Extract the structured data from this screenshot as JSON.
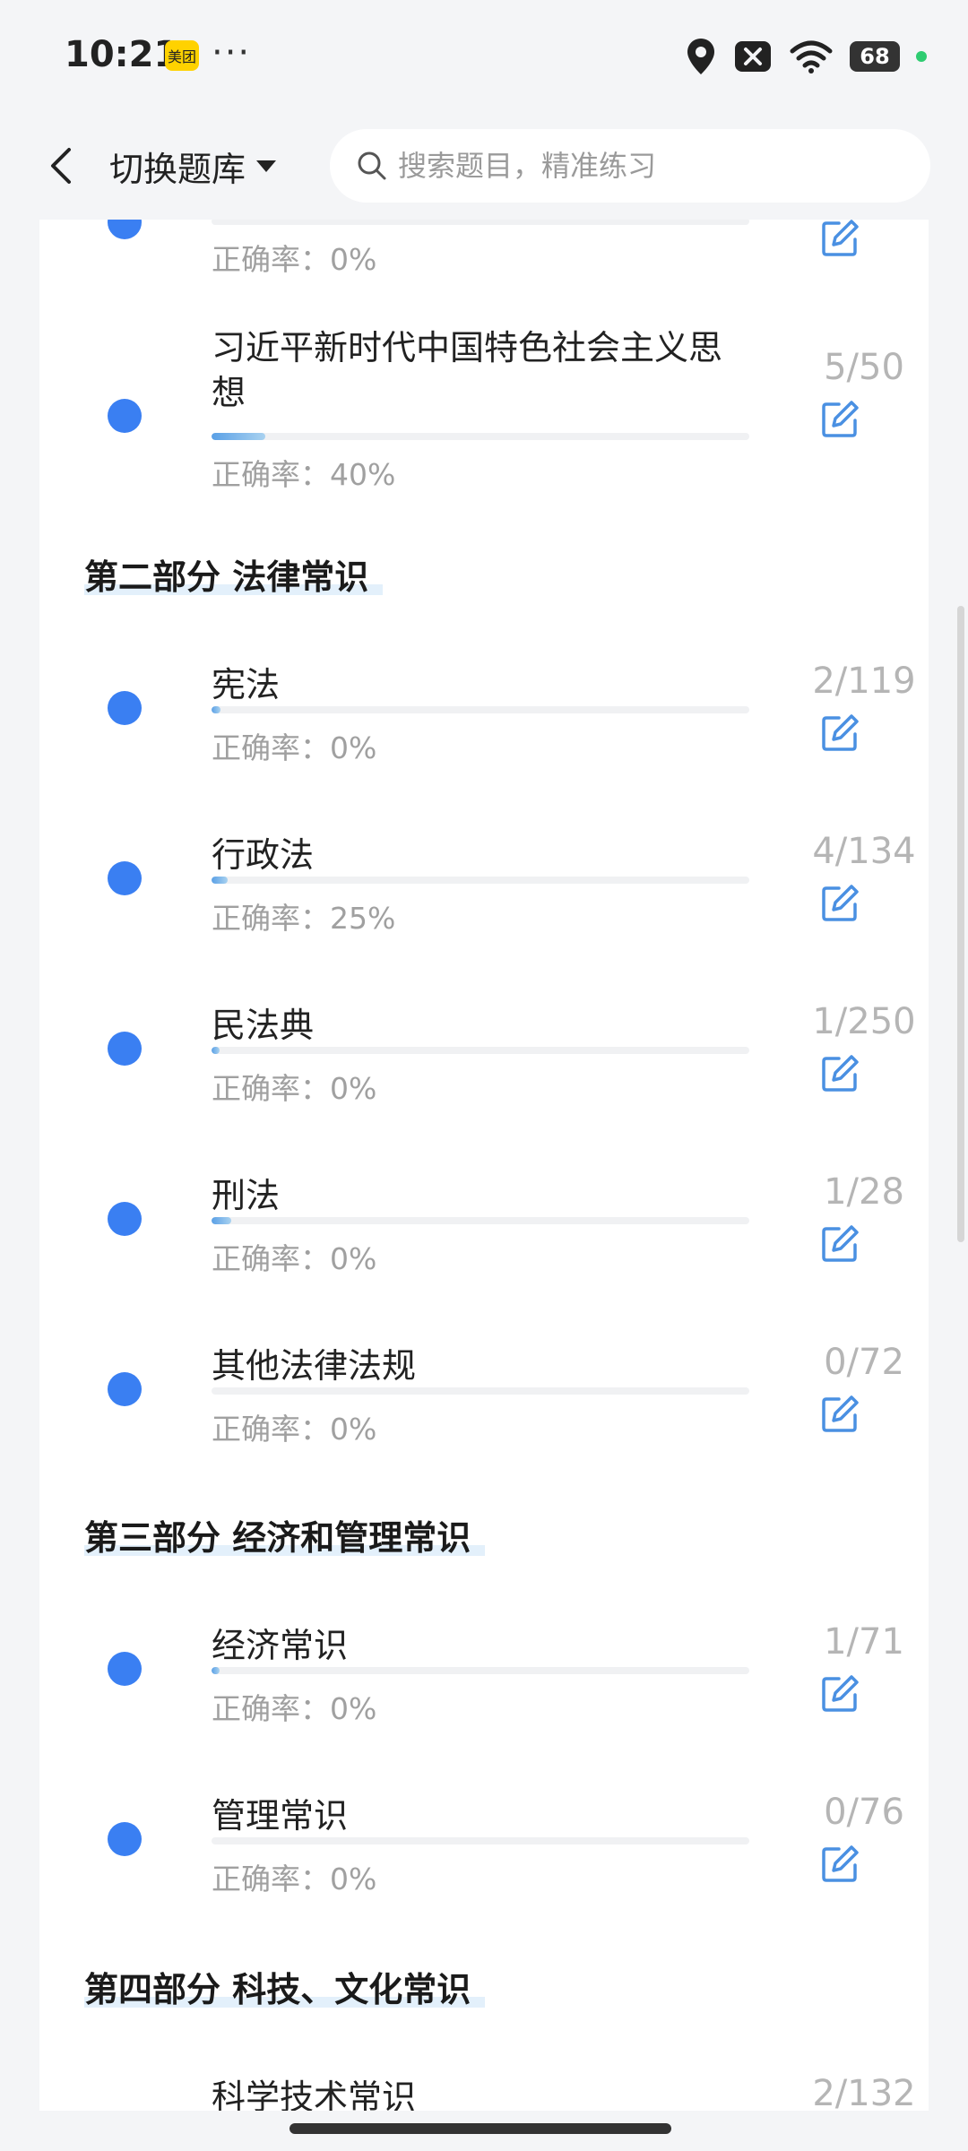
{
  "status_bar": {
    "time": "10:21",
    "app_badge": "美团",
    "more": "···",
    "battery": "68"
  },
  "header": {
    "switch_label": "切换题库",
    "search_placeholder": "搜索题目，精准练习"
  },
  "accuracy_prefix": "正确率：",
  "items_top": [
    {
      "title": "",
      "accuracy": "0%",
      "count": "",
      "progress": 0
    },
    {
      "title": "习近平新时代中国特色社会主义思想",
      "accuracy": "40%",
      "count": "5/50",
      "progress": 0.1
    }
  ],
  "sections": [
    {
      "title": "第二部分  法律常识",
      "items": [
        {
          "title": "宪法",
          "accuracy": "0%",
          "count": "2/119",
          "progress": 0.017
        },
        {
          "title": "行政法",
          "accuracy": "25%",
          "count": "4/134",
          "progress": 0.03
        },
        {
          "title": "民法典",
          "accuracy": "0%",
          "count": "1/250",
          "progress": 0.004
        },
        {
          "title": "刑法",
          "accuracy": "0%",
          "count": "1/28",
          "progress": 0.036
        },
        {
          "title": "其他法律法规",
          "accuracy": "0%",
          "count": "0/72",
          "progress": 0
        }
      ]
    },
    {
      "title": "第三部分  经济和管理常识",
      "items": [
        {
          "title": "经济常识",
          "accuracy": "0%",
          "count": "1/71",
          "progress": 0.014
        },
        {
          "title": "管理常识",
          "accuracy": "0%",
          "count": "0/76",
          "progress": 0
        }
      ]
    },
    {
      "title": "第四部分  科技、文化常识",
      "items": [
        {
          "title": "科学技术常识",
          "accuracy": "",
          "count": "2/132",
          "progress": 0.015
        }
      ]
    }
  ],
  "colors": {
    "accent": "#3a7ff2",
    "edit_icon": "#4a90e2",
    "section_highlight": "#e3f0fb"
  }
}
